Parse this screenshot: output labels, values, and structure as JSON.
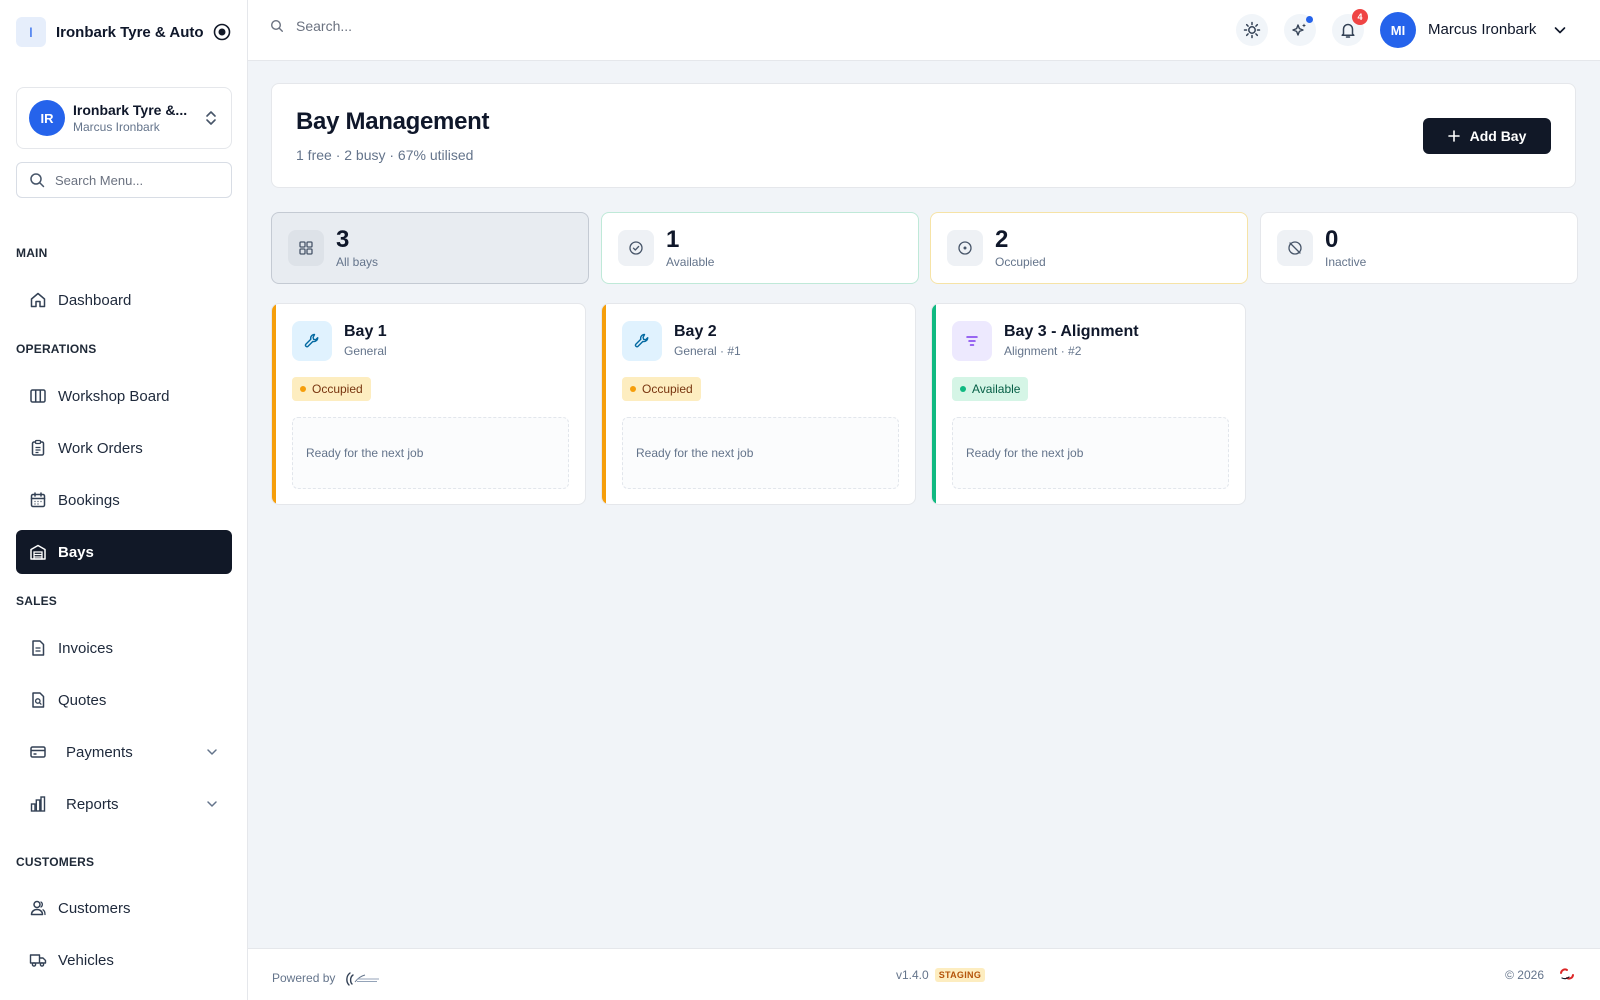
{
  "sidebar": {
    "brand": {
      "initial": "I",
      "name": "Ironbark Tyre & Auto"
    },
    "org": {
      "initials": "IR",
      "name": "Ironbark Tyre &...",
      "user": "Marcus Ironbark"
    },
    "search_placeholder": "Search Menu...",
    "sections": {
      "main": "MAIN",
      "operations": "OPERATIONS",
      "sales": "SALES",
      "customers": "CUSTOMERS"
    },
    "items": {
      "dashboard": "Dashboard",
      "workshop_board": "Workshop Board",
      "work_orders": "Work Orders",
      "bookings": "Bookings",
      "bays": "Bays",
      "invoices": "Invoices",
      "quotes": "Quotes",
      "payments": "Payments",
      "reports": "Reports",
      "customers": "Customers",
      "vehicles": "Vehicles"
    },
    "active_item": "bays"
  },
  "topbar": {
    "search_placeholder": "Search...",
    "notification_count": "4",
    "user": {
      "initials": "MI",
      "name": "Marcus Ironbark"
    }
  },
  "header": {
    "title": "Bay Management",
    "subtitle": "1 free · 2 busy · 67% utilised",
    "add_button": "Add Bay"
  },
  "stats": [
    {
      "value": "3",
      "label": "All bays",
      "icon": "grid-icon"
    },
    {
      "value": "1",
      "label": "Available",
      "icon": "check-circle-icon"
    },
    {
      "value": "2",
      "label": "Occupied",
      "icon": "target-icon"
    },
    {
      "value": "0",
      "label": "Inactive",
      "icon": "off-circle-icon"
    }
  ],
  "bays": [
    {
      "name": "Bay 1",
      "type": "General",
      "status": "Occupied",
      "slot": "Ready for the next job",
      "icon": "wrench-icon"
    },
    {
      "name": "Bay 2",
      "type": "General · #1",
      "status": "Occupied",
      "slot": "Ready for the next job",
      "icon": "wrench-icon"
    },
    {
      "name": "Bay 3 - Alignment",
      "type": "Alignment · #2",
      "status": "Available",
      "slot": "Ready for the next job",
      "icon": "align-icon"
    }
  ],
  "colors": {
    "occupied": "#f59e0b",
    "available": "#10b981",
    "primary": "#111827",
    "brand_blue": "#2563eb"
  },
  "footer": {
    "powered_by": "Powered by",
    "version": "v1.4.0",
    "environment": "STAGING",
    "copyright": "© 2026"
  }
}
